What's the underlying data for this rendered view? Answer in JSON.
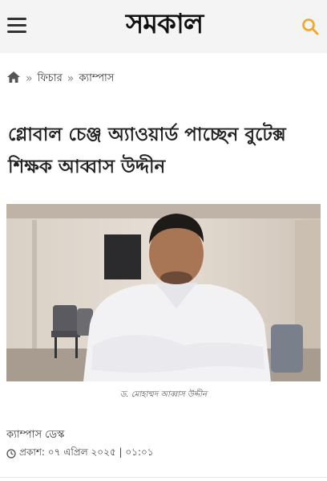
{
  "header": {
    "logo_text": "সমকাল",
    "menu_icon": "hamburger-icon",
    "search_icon": "search-icon",
    "search_color": "#f5a623"
  },
  "breadcrumb": {
    "home_icon": "home-icon",
    "items": [
      "ফিচার",
      "ক্যাম্পাস"
    ]
  },
  "article": {
    "title": "গ্লোবাল চেঞ্জ অ্যাওয়ার্ড পাচ্ছেন বুটেক্স শিক্ষক আব্বাস উদ্দীন",
    "photo_caption": "ড. মোহাম্মদ আব্বাস উদ্দীন",
    "author": "ক্যাম্পাস ডেস্ক",
    "published": "প্রকাশ: ০৭ এপ্রিল ২০২৫ | ০১:০১"
  }
}
